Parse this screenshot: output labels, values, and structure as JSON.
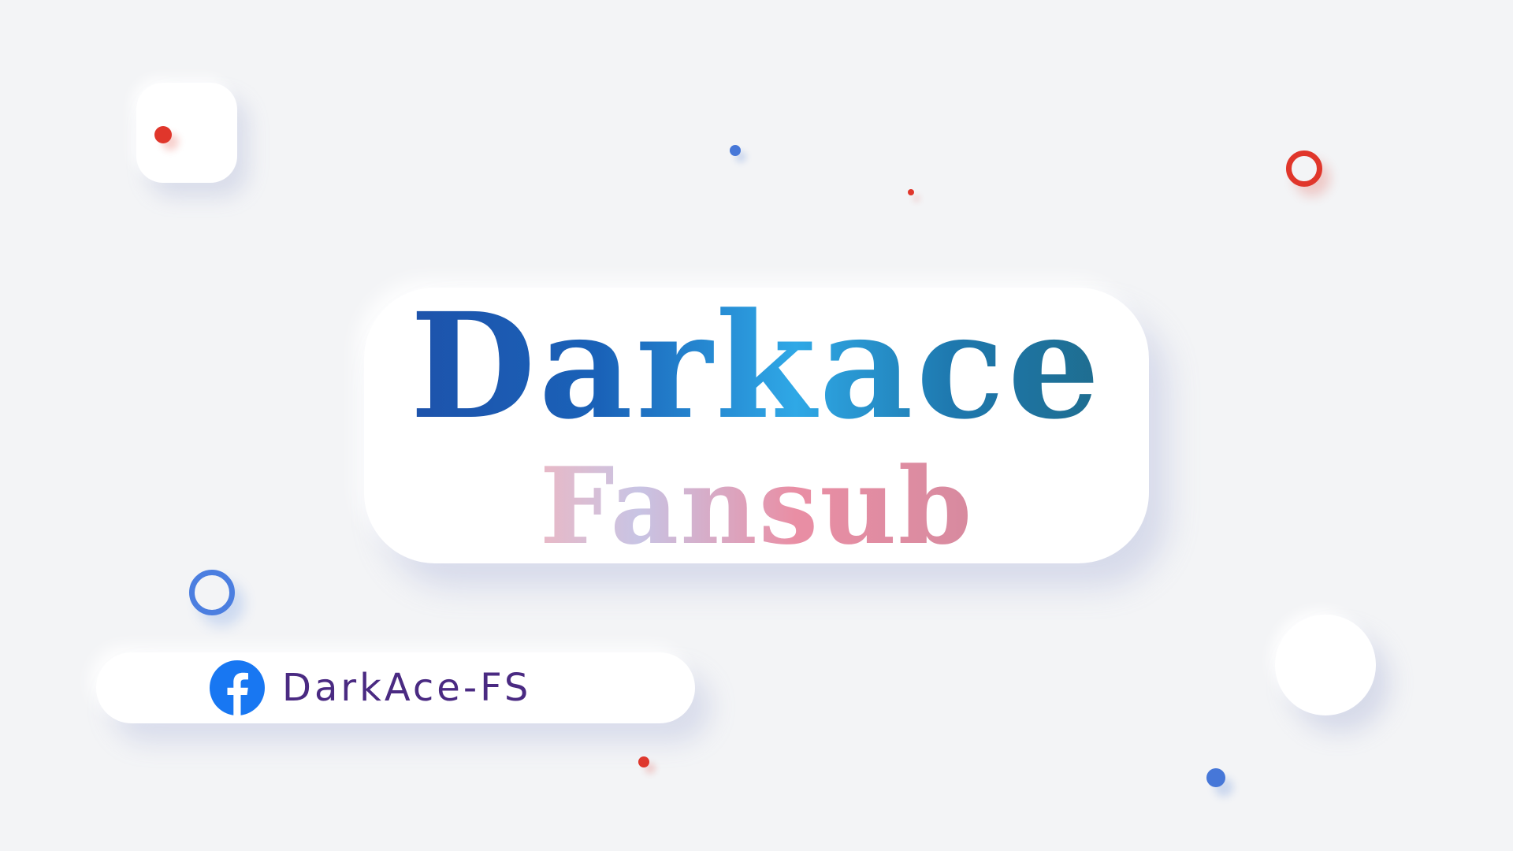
{
  "title": {
    "main": "Darkace",
    "sub": "Fansub"
  },
  "social": {
    "icon": "facebook-icon",
    "handle": "DarkAce-FS"
  },
  "colors": {
    "background": "#f3f4f6",
    "accent_red": "#e0362b",
    "accent_blue": "#4677d8",
    "handle_text": "#4a2a82",
    "facebook_blue": "#1877f2"
  }
}
